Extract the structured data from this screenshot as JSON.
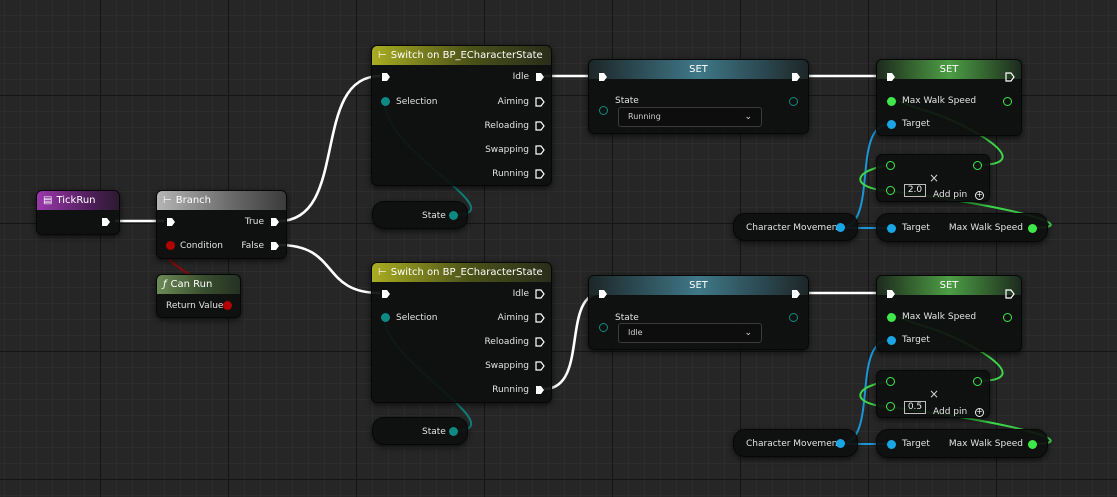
{
  "colors": {
    "exec": "#ffffff",
    "enum": "#0e8a82",
    "bool": "#b30000",
    "object": "#1aa6e6",
    "float": "#3ee84a"
  },
  "tick_run": {
    "title": "TickRun",
    "icon": "event-icon"
  },
  "branch": {
    "title": "Branch",
    "icon": "branch-icon",
    "condition": "Condition",
    "true_label": "True",
    "false_label": "False"
  },
  "can_run": {
    "title": "Can Run",
    "icon": "function-icon",
    "return_value": "Return Value"
  },
  "switch_top": {
    "title": "Switch on BP_ECharacterState",
    "icon": "switch-icon",
    "selection": "Selection",
    "outputs": [
      "Idle",
      "Aiming",
      "Reloading",
      "Swapping",
      "Running"
    ]
  },
  "switch_bottom": {
    "title": "Switch on BP_ECharacterState",
    "icon": "switch-icon",
    "selection": "Selection",
    "outputs": [
      "Idle",
      "Aiming",
      "Reloading",
      "Swapping",
      "Running"
    ]
  },
  "state_getter_top": {
    "label": "State"
  },
  "state_getter_bottom": {
    "label": "State"
  },
  "set_state_top": {
    "title": "SET",
    "state_label": "State",
    "state_value": "Running"
  },
  "set_state_bottom": {
    "title": "SET",
    "state_label": "State",
    "state_value": "Idle"
  },
  "set_speed_top": {
    "title": "SET",
    "max_walk_speed": "Max Walk Speed",
    "target": "Target"
  },
  "set_speed_bottom": {
    "title": "SET",
    "max_walk_speed": "Max Walk Speed",
    "target": "Target"
  },
  "multiply_top": {
    "operator": "×",
    "factor": "2.0",
    "add_pin": "Add pin"
  },
  "multiply_bottom": {
    "operator": "×",
    "factor": "0.5",
    "add_pin": "Add pin"
  },
  "char_movement_top": {
    "label": "Character Movement"
  },
  "char_movement_bottom": {
    "label": "Character Movement"
  },
  "get_speed_top": {
    "target": "Target",
    "max_walk_speed": "Max Walk Speed"
  },
  "get_speed_bottom": {
    "target": "Target",
    "max_walk_speed": "Max Walk Speed"
  }
}
